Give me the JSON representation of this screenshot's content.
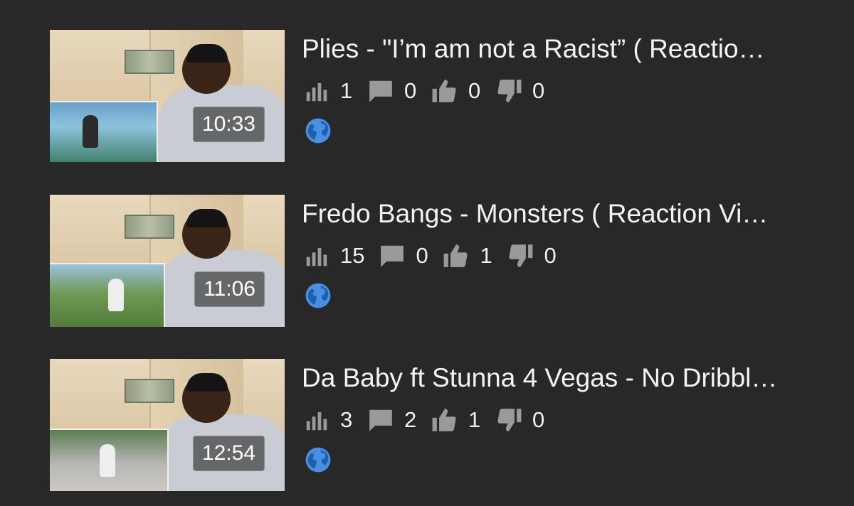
{
  "colors": {
    "background": "#282828",
    "text": "#f1f1f1",
    "icon_gray": "#9a9a9a",
    "globe_blue": "#4a90e2"
  },
  "videos": [
    {
      "title": "Plies - \"I’m am not a Racist” ( Reactio…",
      "duration": "10:33",
      "views": "1",
      "comments": "0",
      "likes": "0",
      "dislikes": "0",
      "visibility_icon": "globe-icon"
    },
    {
      "title": "Fredo Bangs - Monsters ( Reaction Vi…",
      "duration": "11:06",
      "views": "15",
      "comments": "0",
      "likes": "1",
      "dislikes": "0",
      "visibility_icon": "globe-icon"
    },
    {
      "title": "Da Baby ft Stunna 4 Vegas - No Dribbl…",
      "duration": "12:54",
      "views": "3",
      "comments": "2",
      "likes": "1",
      "dislikes": "0",
      "visibility_icon": "globe-icon"
    }
  ]
}
